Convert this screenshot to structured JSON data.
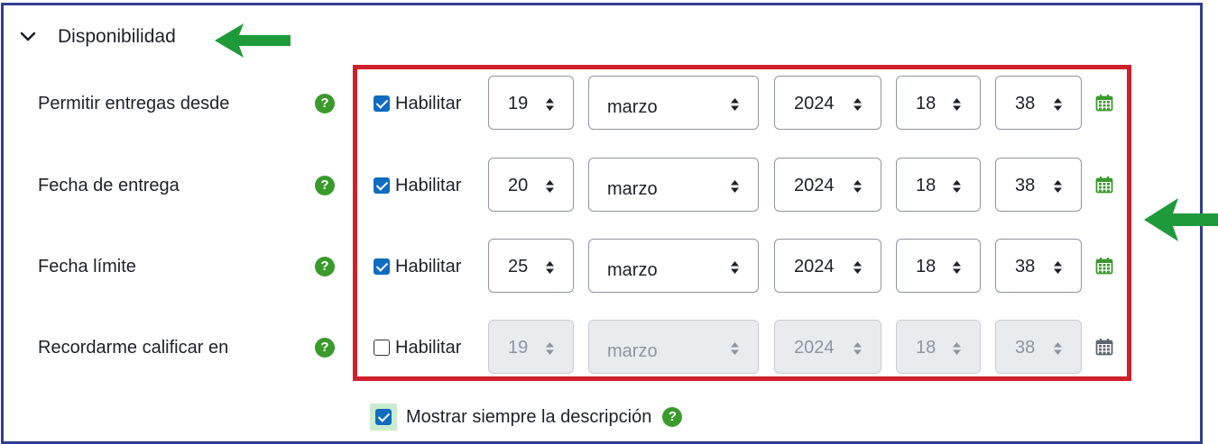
{
  "section": {
    "title": "Disponibilidad",
    "expanded": true
  },
  "help_glyph": "?",
  "rows": [
    {
      "label": "Permitir entregas desde",
      "enable_label": "Habilitar",
      "enabled": true,
      "day": "19",
      "month": "marzo",
      "year": "2024",
      "hour": "18",
      "minute": "38"
    },
    {
      "label": "Fecha de entrega",
      "enable_label": "Habilitar",
      "enabled": true,
      "day": "20",
      "month": "marzo",
      "year": "2024",
      "hour": "18",
      "minute": "38"
    },
    {
      "label": "Fecha límite",
      "enable_label": "Habilitar",
      "enabled": true,
      "day": "25",
      "month": "marzo",
      "year": "2024",
      "hour": "18",
      "minute": "38"
    },
    {
      "label": "Recordarme calificar en",
      "enable_label": "Habilitar",
      "enabled": false,
      "day": "19",
      "month": "marzo",
      "year": "2024",
      "hour": "18",
      "minute": "38"
    }
  ],
  "show_description": {
    "label": "Mostrar siempre la descripción",
    "checked": true
  },
  "colors": {
    "help": "#3a9a2c",
    "calendar_enabled": "#3a9a2c",
    "calendar_disabled": "#5f6570",
    "annotation_box": "#d0202b",
    "annotation_arrow": "#1f9a3a",
    "frame": "#2f3f8f",
    "checkbox": "#0f6cbf"
  },
  "icons": {
    "section_toggle": "chevron-down-icon",
    "help": "question-circle-icon",
    "calendar": "calendar-icon",
    "annotation": "arrow-left-icon"
  }
}
